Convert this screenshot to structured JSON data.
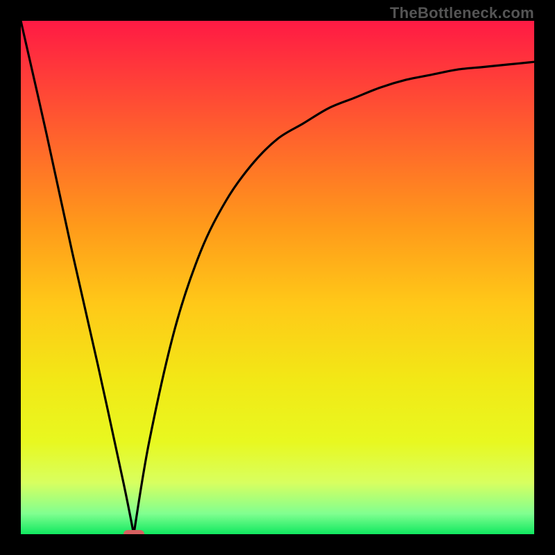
{
  "watermark": "TheBottleneck.com",
  "colors": {
    "frame": "#000000",
    "watermark": "#555555",
    "curve": "#000000",
    "marker": "#d66060",
    "gradient_stops": [
      {
        "offset": 0.0,
        "color": "#ff1a44"
      },
      {
        "offset": 0.1,
        "color": "#ff3a3a"
      },
      {
        "offset": 0.25,
        "color": "#ff6a2a"
      },
      {
        "offset": 0.4,
        "color": "#ff9a1a"
      },
      {
        "offset": 0.55,
        "color": "#ffc818"
      },
      {
        "offset": 0.7,
        "color": "#f2e816"
      },
      {
        "offset": 0.82,
        "color": "#e8f820"
      },
      {
        "offset": 0.9,
        "color": "#d8ff60"
      },
      {
        "offset": 0.96,
        "color": "#80ff90"
      },
      {
        "offset": 1.0,
        "color": "#10e860"
      }
    ]
  },
  "chart_data": {
    "type": "line",
    "title": "",
    "xlabel": "",
    "ylabel": "",
    "x_range": [
      0,
      100
    ],
    "y_range": [
      0,
      100
    ],
    "minimum_x": 22,
    "marker": {
      "x": 22,
      "y": 0
    },
    "series": [
      {
        "name": "curve",
        "x": [
          0,
          5,
          10,
          15,
          20,
          22,
          25,
          30,
          35,
          40,
          45,
          50,
          55,
          60,
          65,
          70,
          75,
          80,
          85,
          90,
          95,
          100
        ],
        "values": [
          100,
          78,
          55,
          33,
          10,
          0,
          18,
          40,
          55,
          65,
          72,
          77,
          80,
          83,
          85,
          87,
          88.5,
          89.5,
          90.5,
          91,
          91.5,
          92
        ]
      }
    ]
  }
}
